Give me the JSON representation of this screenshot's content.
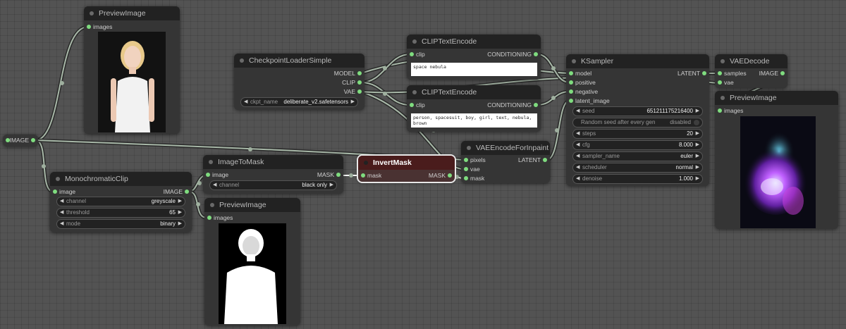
{
  "nodes": {
    "preview_top": {
      "title": "PreviewImage",
      "inputs": [
        "images"
      ]
    },
    "image_src": {
      "out": "IMAGE"
    },
    "mono": {
      "title": "MonochromaticClip",
      "input": "image",
      "output": "IMAGE",
      "widgets": [
        {
          "label": "channel",
          "value": "greyscale"
        },
        {
          "label": "threshold",
          "value": "65"
        },
        {
          "label": "mode",
          "value": "binary"
        }
      ]
    },
    "ckpt": {
      "title": "CheckpointLoaderSimple",
      "outputs": [
        "MODEL",
        "CLIP",
        "VAE"
      ],
      "widget": {
        "label": "ckpt_name",
        "value": "deliberate_v2.safetensors"
      }
    },
    "clip_pos": {
      "title": "CLIPTextEncode",
      "input": "clip",
      "output": "CONDITIONING",
      "text": "space nebula"
    },
    "clip_neg": {
      "title": "CLIPTextEncode",
      "input": "clip",
      "output": "CONDITIONING",
      "text": "person, spacesuit, boy, girl, text, nebula, brown"
    },
    "img2mask": {
      "title": "ImageToMask",
      "input": "image",
      "output": "MASK",
      "widget": {
        "label": "channel",
        "value": "black only"
      }
    },
    "preview_mask": {
      "title": "PreviewImage",
      "inputs": [
        "images"
      ]
    },
    "invert": {
      "title": "InvertMask",
      "input": "mask",
      "output": "MASK"
    },
    "vae_enc": {
      "title": "VAEEncodeForInpaint",
      "inputs": [
        "pixels",
        "vae",
        "mask"
      ],
      "output": "LATENT"
    },
    "ksampler": {
      "title": "KSampler",
      "inputs": [
        "model",
        "positive",
        "negative",
        "latent_image"
      ],
      "output": "LATENT",
      "widgets": [
        {
          "label": "seed",
          "value": "651211175216400"
        },
        {
          "label": "steps",
          "value": "20"
        },
        {
          "label": "cfg",
          "value": "8.000"
        },
        {
          "label": "sampler_name",
          "value": "euler"
        },
        {
          "label": "scheduler",
          "value": "normal"
        },
        {
          "label": "denoise",
          "value": "1.000"
        }
      ],
      "toggle": {
        "label": "Random seed after every gen",
        "value": "disabled"
      }
    },
    "vae_dec": {
      "title": "VAEDecode",
      "inputs": [
        "samples",
        "vae"
      ],
      "output": "IMAGE"
    },
    "preview_out": {
      "title": "PreviewImage",
      "inputs": [
        "images"
      ]
    }
  },
  "colors": {
    "slot": "#7fdc7f",
    "wire": "#8a9a8a",
    "selected_outline": "#e8e8e8"
  }
}
